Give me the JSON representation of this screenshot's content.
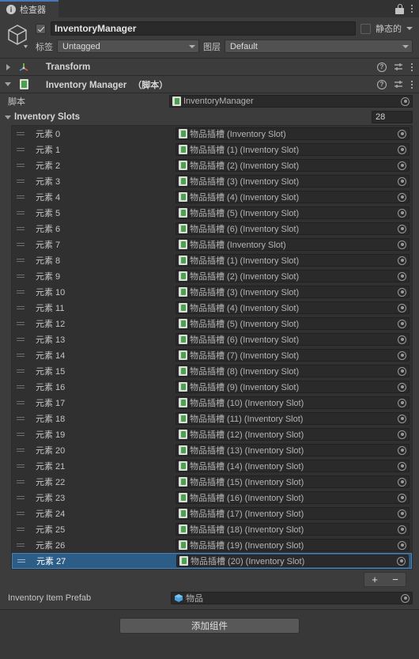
{
  "tab": {
    "label": "检查器",
    "info_icon": "info-icon",
    "lock_icon": "lock-icon",
    "menu_icon": "kebab-menu-icon"
  },
  "gameobject": {
    "enabled": true,
    "name": "InventoryManager",
    "static_label": "静态的",
    "tag_label": "标签",
    "tag_value": "Untagged",
    "layer_label": "图层",
    "layer_value": "Default",
    "thumb_icon": "gameobject-cube-icon"
  },
  "components": [
    {
      "title": "Transform",
      "subtitle": "",
      "expanded": false,
      "icon": "transform-axis-icon"
    },
    {
      "title": "Inventory Manager",
      "subtitle": "（脚本）",
      "expanded": true,
      "icon": "script-icon"
    }
  ],
  "script_row": {
    "label": "脚本",
    "value": "InventoryManager",
    "icon": "script-asset-icon"
  },
  "array": {
    "title": "Inventory Slots",
    "size": "28",
    "element_prefix": "元素",
    "items": [
      {
        "index": "0",
        "label": "元素 0",
        "value": "物品插槽 (Inventory Slot)"
      },
      {
        "index": "1",
        "label": "元素 1",
        "value": "物品插槽 (1) (Inventory Slot)"
      },
      {
        "index": "2",
        "label": "元素 2",
        "value": "物品插槽 (2) (Inventory Slot)"
      },
      {
        "index": "3",
        "label": "元素 3",
        "value": "物品插槽 (3) (Inventory Slot)"
      },
      {
        "index": "4",
        "label": "元素 4",
        "value": "物品插槽 (4) (Inventory Slot)"
      },
      {
        "index": "5",
        "label": "元素 5",
        "value": "物品插槽 (5) (Inventory Slot)"
      },
      {
        "index": "6",
        "label": "元素 6",
        "value": "物品插槽 (6) (Inventory Slot)"
      },
      {
        "index": "7",
        "label": "元素 7",
        "value": "物品插槽 (Inventory Slot)"
      },
      {
        "index": "8",
        "label": "元素 8",
        "value": "物品插槽 (1) (Inventory Slot)"
      },
      {
        "index": "9",
        "label": "元素 9",
        "value": "物品插槽 (2) (Inventory Slot)"
      },
      {
        "index": "10",
        "label": "元素 10",
        "value": "物品插槽 (3) (Inventory Slot)"
      },
      {
        "index": "11",
        "label": "元素 11",
        "value": "物品插槽 (4) (Inventory Slot)"
      },
      {
        "index": "12",
        "label": "元素 12",
        "value": "物品插槽 (5) (Inventory Slot)"
      },
      {
        "index": "13",
        "label": "元素 13",
        "value": "物品插槽 (6) (Inventory Slot)"
      },
      {
        "index": "14",
        "label": "元素 14",
        "value": "物品插槽 (7) (Inventory Slot)"
      },
      {
        "index": "15",
        "label": "元素 15",
        "value": "物品插槽 (8) (Inventory Slot)"
      },
      {
        "index": "16",
        "label": "元素 16",
        "value": "物品插槽 (9) (Inventory Slot)"
      },
      {
        "index": "17",
        "label": "元素 17",
        "value": "物品插槽 (10) (Inventory Slot)"
      },
      {
        "index": "18",
        "label": "元素 18",
        "value": "物品插槽 (11) (Inventory Slot)"
      },
      {
        "index": "19",
        "label": "元素 19",
        "value": "物品插槽 (12) (Inventory Slot)"
      },
      {
        "index": "20",
        "label": "元素 20",
        "value": "物品插槽 (13) (Inventory Slot)"
      },
      {
        "index": "21",
        "label": "元素 21",
        "value": "物品插槽 (14) (Inventory Slot)"
      },
      {
        "index": "22",
        "label": "元素 22",
        "value": "物品插槽 (15) (Inventory Slot)"
      },
      {
        "index": "23",
        "label": "元素 23",
        "value": "物品插槽 (16) (Inventory Slot)"
      },
      {
        "index": "24",
        "label": "元素 24",
        "value": "物品插槽 (17) (Inventory Slot)"
      },
      {
        "index": "25",
        "label": "元素 25",
        "value": "物品插槽 (18) (Inventory Slot)"
      },
      {
        "index": "26",
        "label": "元素 26",
        "value": "物品插槽 (19) (Inventory Slot)"
      },
      {
        "index": "27",
        "label": "元素 27",
        "value": "物品插槽 (20) (Inventory Slot)",
        "selected": true
      }
    ],
    "add_label": "+",
    "remove_label": "−"
  },
  "prefab_row": {
    "label": "Inventory Item Prefab",
    "value": "物品",
    "icon": "prefab-cube-icon"
  },
  "add_component_button": "添加组件",
  "colors": {
    "selection_blue": "#2c5d87",
    "tab_accent": "#4a77b8",
    "panel_bg": "#383838",
    "header_bg": "#3c3c3c",
    "field_bg": "#2a2a2a"
  }
}
